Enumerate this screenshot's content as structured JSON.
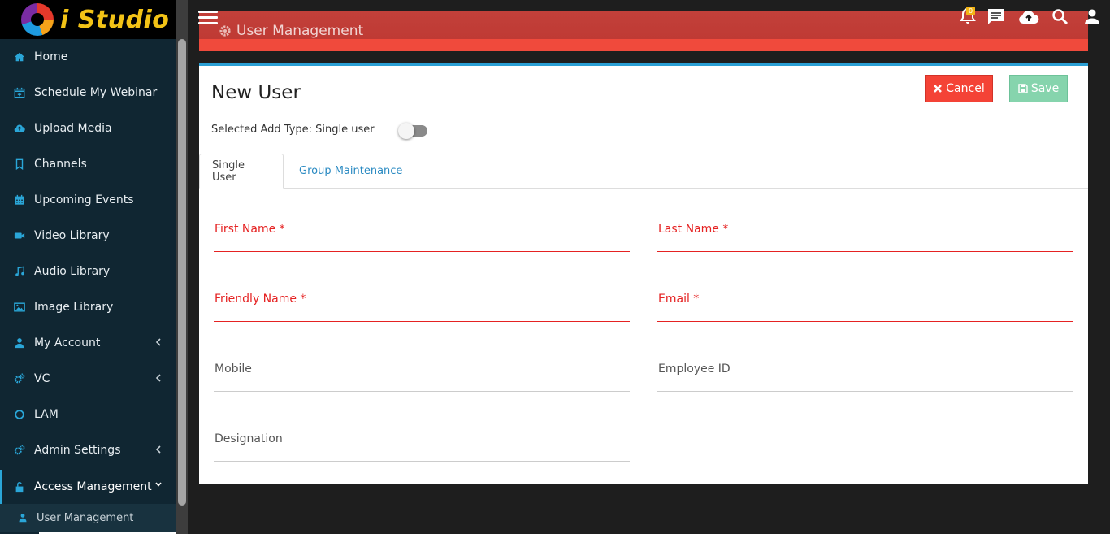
{
  "app": {
    "brand": "i Studio"
  },
  "sidebar": {
    "items": [
      {
        "label": "Home",
        "icon": "home-icon"
      },
      {
        "label": "Schedule My Webinar",
        "icon": "calendar-plus-icon"
      },
      {
        "label": "Upload Media",
        "icon": "cloud-upload-icon"
      },
      {
        "label": "Channels",
        "icon": "bookmark-icon"
      },
      {
        "label": "Upcoming Events",
        "icon": "calendar-icon"
      },
      {
        "label": "Video Library",
        "icon": "video-camera-icon"
      },
      {
        "label": "Audio Library",
        "icon": "music-note-icon"
      },
      {
        "label": "Image Library",
        "icon": "image-icon"
      },
      {
        "label": "My Account",
        "icon": "user-icon"
      },
      {
        "label": "VC",
        "icon": "gears-icon"
      },
      {
        "label": "LAM",
        "icon": "circle-icon"
      },
      {
        "label": "Admin Settings",
        "icon": "gears-icon"
      },
      {
        "label": "Access Management",
        "icon": "unlock-icon"
      }
    ],
    "sub_item": {
      "label": "User Management",
      "icon": "user-icon"
    }
  },
  "header": {
    "title": "User Management",
    "notification_count": "0",
    "icons": [
      "menu-icon",
      "bell-icon",
      "chat-icon",
      "cloud-upload-icon",
      "search-icon",
      "user-icon"
    ]
  },
  "card": {
    "title": "New User",
    "add_type_label": "Selected Add Type: Single user",
    "toggle_on": false,
    "cancel_label": "Cancel",
    "save_label": "Save",
    "tabs": [
      {
        "label": "Single User",
        "active": true
      },
      {
        "label": "Group Maintenance",
        "active": false
      }
    ],
    "fields": {
      "first_name": "First Name *",
      "last_name": "Last Name *",
      "friendly_name": "Friendly Name *",
      "email": "Email *",
      "mobile": "Mobile",
      "employee_id": "Employee ID",
      "designation": "Designation"
    }
  },
  "colors": {
    "sidebar_bg": "#102632",
    "accent": "#2aa6d8",
    "header_red": "#f04a3c",
    "cancel_red": "#f44336",
    "save_green": "#86d4ad",
    "required_red": "#e52222",
    "brand_yellow": "#f3c316"
  }
}
